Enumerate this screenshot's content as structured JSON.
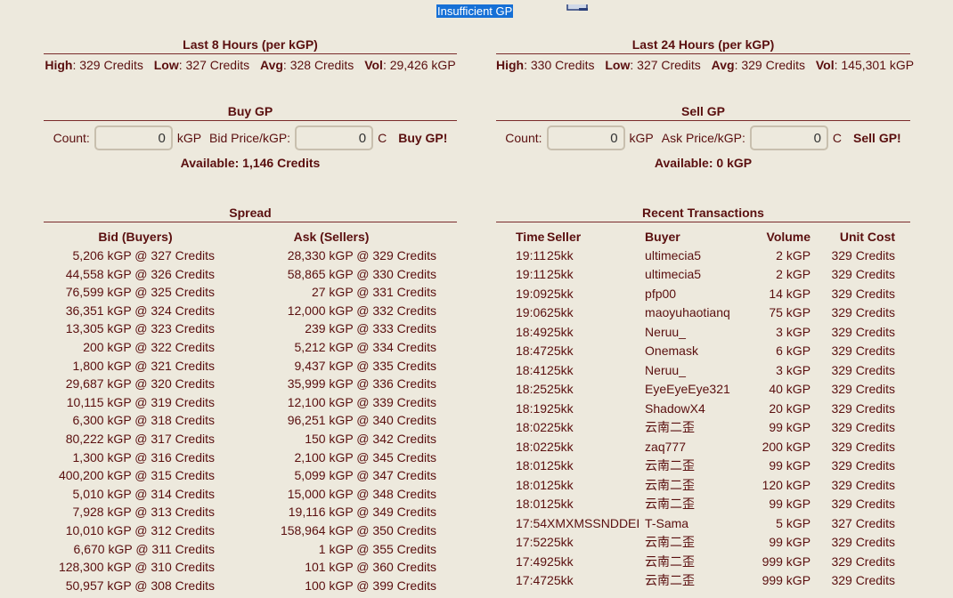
{
  "notice": "Insufficient GP",
  "icons": {
    "top": "monitor-icon"
  },
  "last8": {
    "title": "Last 8 Hours (per kGP)",
    "high_label": "High",
    "high": "329 Credits",
    "low_label": "Low",
    "low": "327 Credits",
    "avg_label": "Avg",
    "avg": "328 Credits",
    "vol_label": "Vol",
    "vol": "29,426 kGP"
  },
  "last24": {
    "title": "Last 24 Hours (per kGP)",
    "high_label": "High",
    "high": "330 Credits",
    "low_label": "Low",
    "low": "327 Credits",
    "avg_label": "Avg",
    "avg": "329 Credits",
    "vol_label": "Vol",
    "vol": "145,301 kGP"
  },
  "buy": {
    "title": "Buy GP",
    "count_label": "Count:",
    "count_value": "0",
    "count_unit": "kGP",
    "price_label": "Bid Price/kGP:",
    "price_value": "0",
    "price_unit": "C",
    "button": "Buy GP!",
    "available": "Available: 1,146 Credits"
  },
  "sell": {
    "title": "Sell GP",
    "count_label": "Count:",
    "count_value": "0",
    "count_unit": "kGP",
    "price_label": "Ask Price/kGP:",
    "price_value": "0",
    "price_unit": "C",
    "button": "Sell GP!",
    "available": "Available: 0 kGP"
  },
  "spread": {
    "title": "Spread",
    "bid_header": "Bid (Buyers)",
    "ask_header": "Ask (Sellers)",
    "rows": [
      {
        "bid": "5,206 kGP @ 327 Credits",
        "ask": "28,330 kGP @ 329 Credits"
      },
      {
        "bid": "44,558 kGP @ 326 Credits",
        "ask": "58,865 kGP @ 330 Credits"
      },
      {
        "bid": "76,599 kGP @ 325 Credits",
        "ask": "27 kGP @ 331 Credits"
      },
      {
        "bid": "36,351 kGP @ 324 Credits",
        "ask": "12,000 kGP @ 332 Credits"
      },
      {
        "bid": "13,305 kGP @ 323 Credits",
        "ask": "239 kGP @ 333 Credits"
      },
      {
        "bid": "200 kGP @ 322 Credits",
        "ask": "5,212 kGP @ 334 Credits"
      },
      {
        "bid": "1,800 kGP @ 321 Credits",
        "ask": "9,437 kGP @ 335 Credits"
      },
      {
        "bid": "29,687 kGP @ 320 Credits",
        "ask": "35,999 kGP @ 336 Credits"
      },
      {
        "bid": "10,115 kGP @ 319 Credits",
        "ask": "12,100 kGP @ 339 Credits"
      },
      {
        "bid": "6,300 kGP @ 318 Credits",
        "ask": "96,251 kGP @ 340 Credits"
      },
      {
        "bid": "80,222 kGP @ 317 Credits",
        "ask": "150 kGP @ 342 Credits"
      },
      {
        "bid": "1,300 kGP @ 316 Credits",
        "ask": "2,100 kGP @ 345 Credits"
      },
      {
        "bid": "400,200 kGP @ 315 Credits",
        "ask": "5,099 kGP @ 347 Credits"
      },
      {
        "bid": "5,010 kGP @ 314 Credits",
        "ask": "15,000 kGP @ 348 Credits"
      },
      {
        "bid": "7,928 kGP @ 313 Credits",
        "ask": "19,116 kGP @ 349 Credits"
      },
      {
        "bid": "10,010 kGP @ 312 Credits",
        "ask": "158,964 kGP @ 350 Credits"
      },
      {
        "bid": "6,670 kGP @ 311 Credits",
        "ask": "1 kGP @ 355 Credits"
      },
      {
        "bid": "128,300 kGP @ 310 Credits",
        "ask": "101 kGP @ 360 Credits"
      },
      {
        "bid": "50,957 kGP @ 308 Credits",
        "ask": "100 kGP @ 399 Credits"
      }
    ]
  },
  "transactions": {
    "title": "Recent Transactions",
    "headers": {
      "time": "Time",
      "seller": "Seller",
      "buyer": "Buyer",
      "volume": "Volume",
      "cost": "Unit Cost"
    },
    "rows": [
      {
        "time": "19:11",
        "seller": "25kk",
        "buyer": "ultimecia5",
        "volume": "2 kGP",
        "cost": "329 Credits"
      },
      {
        "time": "19:11",
        "seller": "25kk",
        "buyer": "ultimecia5",
        "volume": "2 kGP",
        "cost": "329 Credits"
      },
      {
        "time": "19:09",
        "seller": "25kk",
        "buyer": "pfp00",
        "volume": "14 kGP",
        "cost": "329 Credits"
      },
      {
        "time": "19:06",
        "seller": "25kk",
        "buyer": "maoyuhaotianq",
        "volume": "75 kGP",
        "cost": "329 Credits"
      },
      {
        "time": "18:49",
        "seller": "25kk",
        "buyer": "Neruu_",
        "volume": "3 kGP",
        "cost": "329 Credits"
      },
      {
        "time": "18:47",
        "seller": "25kk",
        "buyer": "Onemask",
        "volume": "6 kGP",
        "cost": "329 Credits"
      },
      {
        "time": "18:41",
        "seller": "25kk",
        "buyer": "Neruu_",
        "volume": "3 kGP",
        "cost": "329 Credits"
      },
      {
        "time": "18:25",
        "seller": "25kk",
        "buyer": "EyeEyeEye321",
        "volume": "40 kGP",
        "cost": "329 Credits"
      },
      {
        "time": "18:19",
        "seller": "25kk",
        "buyer": "ShadowX4",
        "volume": "20 kGP",
        "cost": "329 Credits"
      },
      {
        "time": "18:02",
        "seller": "25kk",
        "buyer": "云南二歪",
        "volume": "99 kGP",
        "cost": "329 Credits"
      },
      {
        "time": "18:02",
        "seller": "25kk",
        "buyer": "zaq777",
        "volume": "200 kGP",
        "cost": "329 Credits"
      },
      {
        "time": "18:01",
        "seller": "25kk",
        "buyer": "云南二歪",
        "volume": "99 kGP",
        "cost": "329 Credits"
      },
      {
        "time": "18:01",
        "seller": "25kk",
        "buyer": "云南二歪",
        "volume": "120 kGP",
        "cost": "329 Credits"
      },
      {
        "time": "18:01",
        "seller": "25kk",
        "buyer": "云南二歪",
        "volume": "99 kGP",
        "cost": "329 Credits"
      },
      {
        "time": "17:54",
        "seller": "XMXMSSNDDEI",
        "buyer": "T-Sama",
        "volume": "5 kGP",
        "cost": "327 Credits"
      },
      {
        "time": "17:52",
        "seller": "25kk",
        "buyer": "云南二歪",
        "volume": "99 kGP",
        "cost": "329 Credits"
      },
      {
        "time": "17:49",
        "seller": "25kk",
        "buyer": "云南二歪",
        "volume": "999 kGP",
        "cost": "329 Credits"
      },
      {
        "time": "17:47",
        "seller": "25kk",
        "buyer": "云南二歪",
        "volume": "999 kGP",
        "cost": "329 Credits"
      }
    ]
  }
}
